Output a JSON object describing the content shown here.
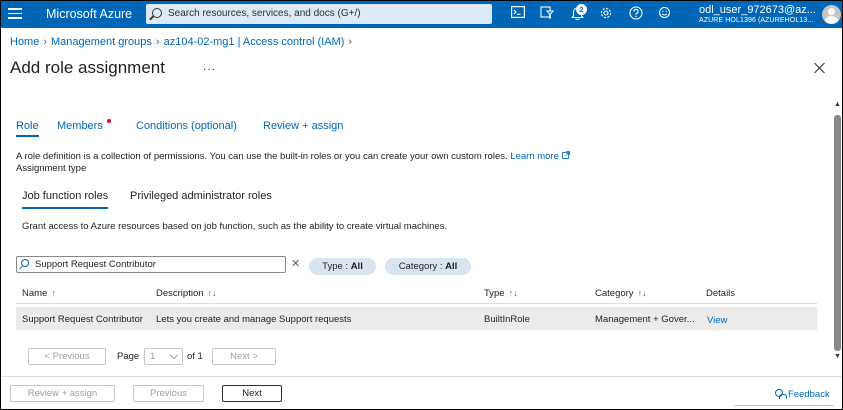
{
  "topbar": {
    "brand": "Microsoft Azure",
    "search_placeholder": "Search resources, services, and docs (G+/)",
    "notifications_count": "2",
    "user_name": "odl_user_972673@az...",
    "user_tenant": "AZURE HOL1396 (AZUREHOL13...",
    "icons": [
      "terminal-icon",
      "directory-filter-icon",
      "bell-icon",
      "gear-icon",
      "help-icon",
      "feedback-smile-icon"
    ]
  },
  "breadcrumb": {
    "items": [
      "Home",
      "Management groups",
      "az104-02-mg1 | Access control (IAM)"
    ]
  },
  "page": {
    "title": "Add role assignment",
    "more": "..."
  },
  "tabs": {
    "items": [
      "Role",
      "Members",
      "Conditions (optional)",
      "Review + assign"
    ],
    "active": "Role"
  },
  "role": {
    "description": "A role definition is a collection of permissions. You can use the built-in roles or you can create your own custom roles.",
    "learn_more": "Learn more",
    "assignment_type_label": "Assignment type",
    "subtabs": [
      "Job function roles",
      "Privileged administrator roles"
    ],
    "grant_text": "Grant access to Azure resources based on job function, such as the ability to create virtual machines.",
    "search_value": "Support Request Contributor",
    "filter_type_label": "Type : ",
    "filter_type_value": "All",
    "filter_category_label": "Category : ",
    "filter_category_value": "All"
  },
  "table": {
    "headers": [
      "Name",
      "Description",
      "Type",
      "Category",
      "Details"
    ],
    "rows": [
      {
        "name": "Support Request Contributor",
        "description": "Lets you create and manage Support requests",
        "type": "BuiltInRole",
        "category": "Management + Gover...",
        "details": "View"
      }
    ]
  },
  "pagination": {
    "previous": "< Previous",
    "page_label": "Page",
    "page_value": "1",
    "of_label": "of 1",
    "next": "Next >"
  },
  "footer": {
    "review_assign": "Review + assign",
    "previous": "Previous",
    "next": "Next",
    "feedback": "Feedback"
  }
}
